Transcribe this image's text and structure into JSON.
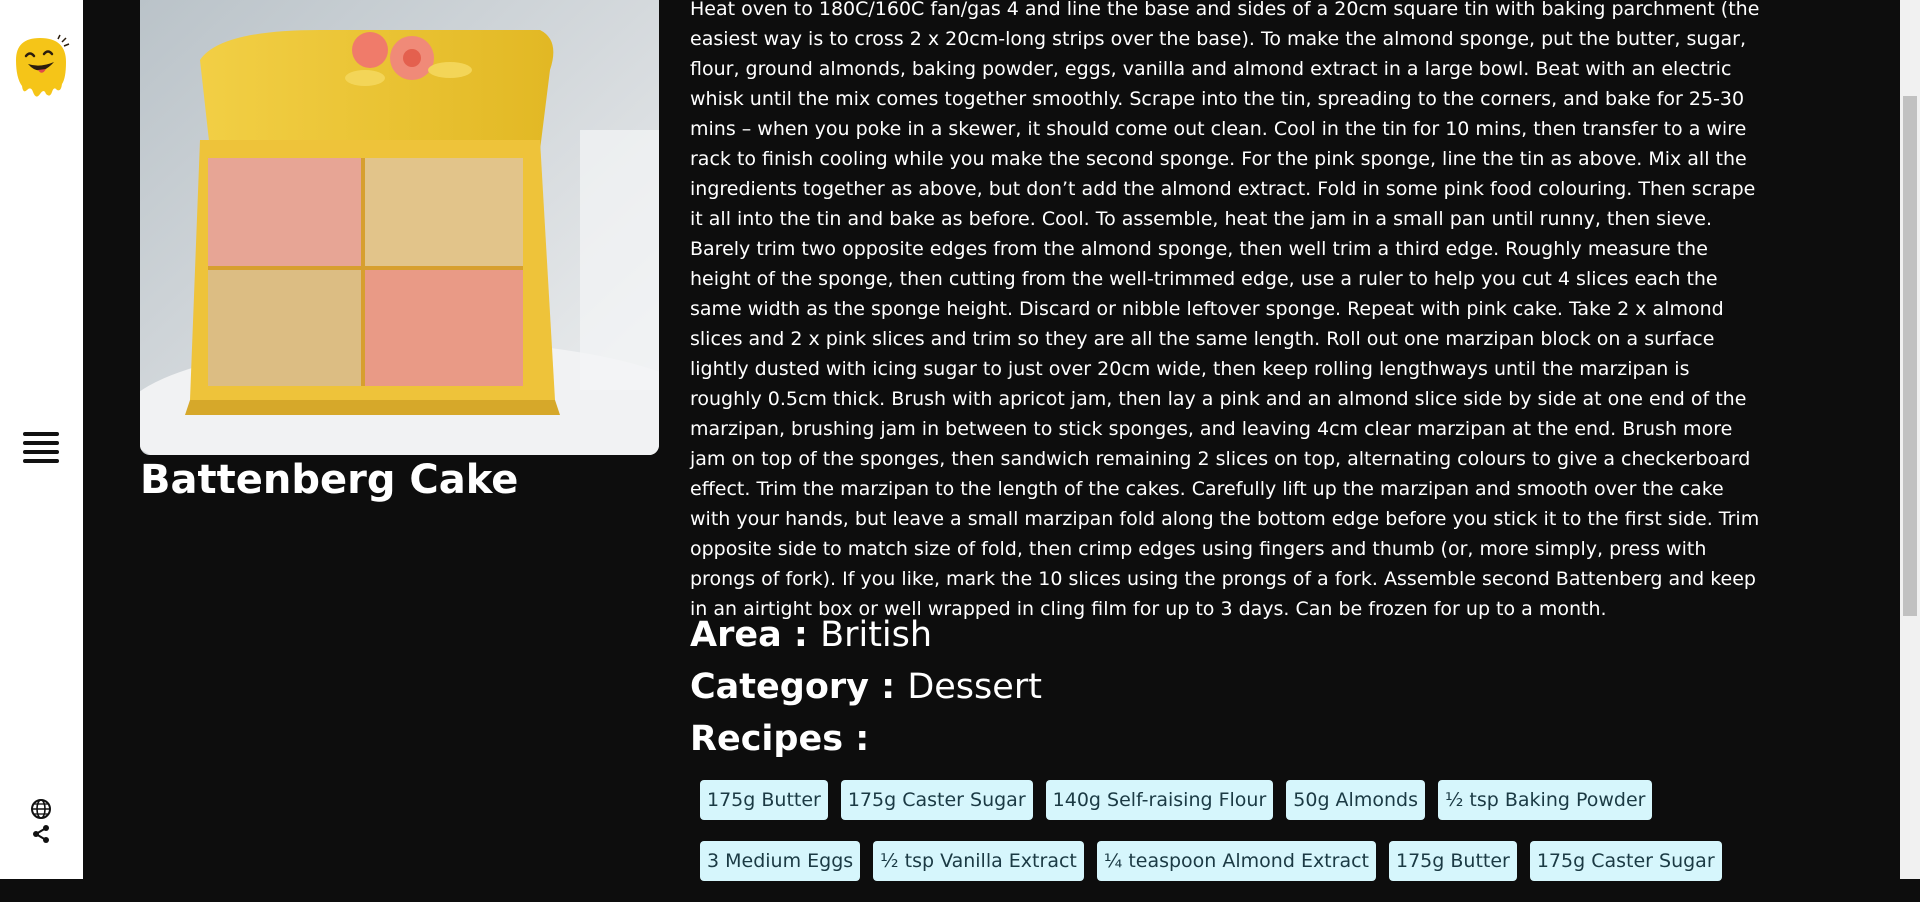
{
  "meal": {
    "title": "Battenberg Cake",
    "instructions": "Heat oven to 180C/160C fan/gas 4 and line the base and sides of a 20cm square tin with baking parchment (the easiest way is to cross 2 x 20cm-long strips over the base). To make the almond sponge, put the butter, sugar, flour, ground almonds, baking powder, eggs, vanilla and almond extract in a large bowl. Beat with an electric whisk until the mix comes together smoothly. Scrape into the tin, spreading to the corners, and bake for 25-30 mins – when you poke in a skewer, it should come out clean. Cool in the tin for 10 mins, then transfer to a wire rack to finish cooling while you make the second sponge. For the pink sponge, line the tin as above. Mix all the ingredients together as above, but don’t add the almond extract. Fold in some pink food colouring. Then scrape it all into the tin and bake as before. Cool. To assemble, heat the jam in a small pan until runny, then sieve. Barely trim two opposite edges from the almond sponge, then well trim a third edge. Roughly measure the height of the sponge, then cutting from the well-trimmed edge, use a ruler to help you cut 4 slices each the same width as the sponge height. Discard or nibble leftover sponge. Repeat with pink cake. Take 2 x almond slices and 2 x pink slices and trim so they are all the same length. Roll out one marzipan block on a surface lightly dusted with icing sugar to just over 20cm wide, then keep rolling lengthways until the marzipan is roughly 0.5cm thick. Brush with apricot jam, then lay a pink and an almond slice side by side at one end of the marzipan, brushing jam in between to stick sponges, and leaving 4cm clear marzipan at the end. Brush more jam on top of the sponges, then sandwich remaining 2 slices on top, alternating colours to give a checkerboard effect. Trim the marzipan to the length of the cakes. Carefully lift up the marzipan and smooth over the cake with your hands, but leave a small marzipan fold along the bottom edge before you stick it to the first side. Trim opposite side to match size of fold, then crimp edges using fingers and thumb (or, more simply, press with prongs of fork). If you like, mark the 10 slices using the prongs of a fork. Assemble second Battenberg and keep in an airtight box or well wrapped in cling film for up to 3 days. Can be frozen for up to a month.",
    "area_label": "Area : ",
    "area_value": "British",
    "category_label": "Category : ",
    "category_value": "Dessert",
    "recipes_label": "Recipes :",
    "ingredients_row1": [
      "175g Butter",
      "175g Caster Sugar",
      "140g Self-raising Flour",
      "50g Almonds",
      "½ tsp Baking Powder"
    ],
    "ingredients_row2": [
      "3 Medium Eggs",
      "½ tsp Vanilla Extract",
      "¼ teaspoon Almond Extract",
      "175g Butter",
      "175g Caster Sugar"
    ]
  },
  "sidebar": {
    "logo_icon": "smiley-drip-logo",
    "menu_icon": "hamburger-menu-icon",
    "globe_icon": "globe-icon",
    "share_icon": "share-icon"
  },
  "colors": {
    "background": "#0d0d0d",
    "sidebar": "#ffffff",
    "tag_bg": "#d6f6fc",
    "logo": "#f5c518"
  }
}
